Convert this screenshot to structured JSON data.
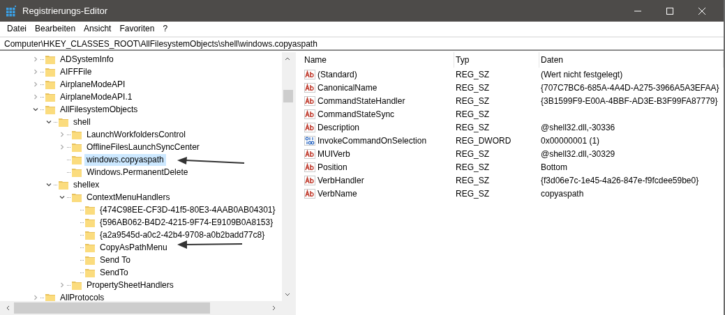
{
  "window": {
    "title": "Registrierungs-Editor"
  },
  "menu": [
    "Datei",
    "Bearbeiten",
    "Ansicht",
    "Favoriten",
    "?"
  ],
  "address": "Computer\\HKEY_CLASSES_ROOT\\AllFilesystemObjects\\shell\\windows.copyaspath",
  "tree": [
    {
      "label": "ADSystemInfo",
      "expanded": false,
      "selected": false
    },
    {
      "label": "AIFFFile",
      "expanded": false,
      "selected": false
    },
    {
      "label": "AirplaneModeAPI",
      "expanded": false,
      "selected": false
    },
    {
      "label": "AirplaneModeAPI.1",
      "expanded": false,
      "selected": false
    },
    {
      "label": "AllFilesystemObjects",
      "expanded": true,
      "selected": false,
      "children": [
        {
          "label": "shell",
          "expanded": true,
          "selected": false,
          "children": [
            {
              "label": "LaunchWorkfoldersControl",
              "expanded": false,
              "selected": false
            },
            {
              "label": "OfflineFilesLaunchSyncCenter",
              "expanded": false,
              "selected": false
            },
            {
              "label": "windows.copyaspath",
              "selected": true
            },
            {
              "label": "Windows.PermanentDelete",
              "selected": false
            }
          ]
        },
        {
          "label": "shellex",
          "expanded": true,
          "selected": false,
          "children": [
            {
              "label": "ContextMenuHandlers",
              "expanded": true,
              "selected": false,
              "children": [
                {
                  "label": "{474C98EE-CF3D-41f5-80E3-4AAB0AB04301}",
                  "selected": false
                },
                {
                  "label": "{596AB062-B4D2-4215-9F74-E9109B0A8153}",
                  "selected": false
                },
                {
                  "label": "{a2a9545d-a0c2-42b4-9708-a0b2badd77c8}",
                  "selected": false
                },
                {
                  "label": "CopyAsPathMenu",
                  "selected": false
                },
                {
                  "label": "Send To",
                  "selected": false
                },
                {
                  "label": "SendTo",
                  "selected": false
                }
              ]
            },
            {
              "label": "PropertySheetHandlers",
              "expanded": false,
              "selected": false
            }
          ]
        }
      ]
    },
    {
      "label": "AllProtocols",
      "expanded": false,
      "selected": false
    }
  ],
  "table": {
    "columns": [
      "Name",
      "Typ",
      "Daten"
    ],
    "rows": [
      {
        "kind": "string",
        "name": "(Standard)",
        "type": "REG_SZ",
        "data": "(Wert nicht festgelegt)"
      },
      {
        "kind": "string",
        "name": "CanonicalName",
        "type": "REG_SZ",
        "data": "{707C7BC6-685A-4A4D-A275-3966A5A3EFAA}"
      },
      {
        "kind": "string",
        "name": "CommandStateHandler",
        "type": "REG_SZ",
        "data": "{3B1599F9-E00A-4BBF-AD3E-B3F99FA87779}"
      },
      {
        "kind": "string",
        "name": "CommandStateSync",
        "type": "REG_SZ"
      },
      {
        "kind": "string",
        "name": "Description",
        "type": "REG_SZ",
        "data": "@shell32.dll,-30336"
      },
      {
        "kind": "binary",
        "name": "InvokeCommandOnSelection",
        "type": "REG_DWORD",
        "data": "0x00000001 (1)"
      },
      {
        "kind": "string",
        "name": "MUIVerb",
        "type": "REG_SZ",
        "data": "@shell32.dll,-30329"
      },
      {
        "kind": "string",
        "name": "Position",
        "type": "REG_SZ",
        "data": "Bottom"
      },
      {
        "kind": "string",
        "name": "VerbHandler",
        "type": "REG_SZ",
        "data": "{f3d06e7c-1e45-4a26-847e-f9fcdee59be0}"
      },
      {
        "kind": "string",
        "name": "VerbName",
        "type": "REG_SZ",
        "data": "copyaspath"
      }
    ]
  }
}
